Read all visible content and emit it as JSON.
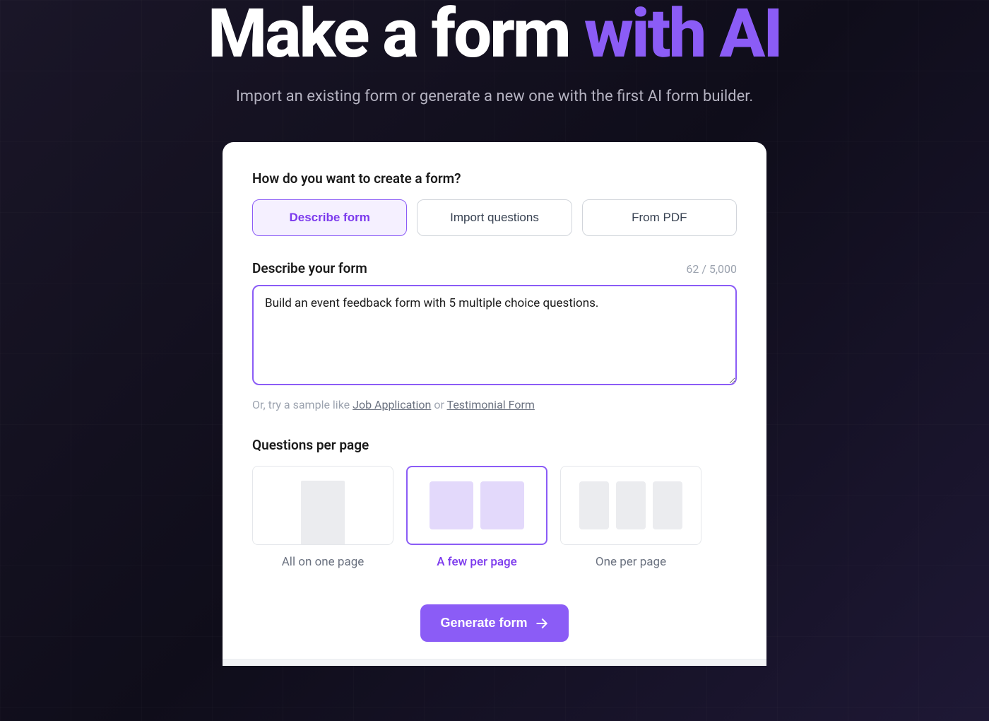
{
  "hero": {
    "title_part1": "Make a form ",
    "title_part2": "with AI",
    "subtitle": "Import an existing form or generate a new one with the first AI form builder."
  },
  "card": {
    "method_label": "How do you want to create a form?",
    "method_tabs": [
      {
        "label": "Describe form",
        "active": true
      },
      {
        "label": "Import questions",
        "active": false
      },
      {
        "label": "From PDF",
        "active": false
      }
    ],
    "describe": {
      "label": "Describe your form",
      "char_count": "62 / 5,000",
      "value": "Build an event feedback form with 5 multiple choice questions.",
      "hint_prefix": "Or, try a sample like ",
      "hint_link1": "Job Application",
      "hint_joiner": " or ",
      "hint_link2": "Testimonial Form"
    },
    "layout": {
      "label": "Questions per page",
      "options": [
        {
          "label": "All on one page",
          "active": false
        },
        {
          "label": "A few per page",
          "active": true
        },
        {
          "label": "One per page",
          "active": false
        }
      ]
    },
    "generate_button": "Generate form"
  }
}
